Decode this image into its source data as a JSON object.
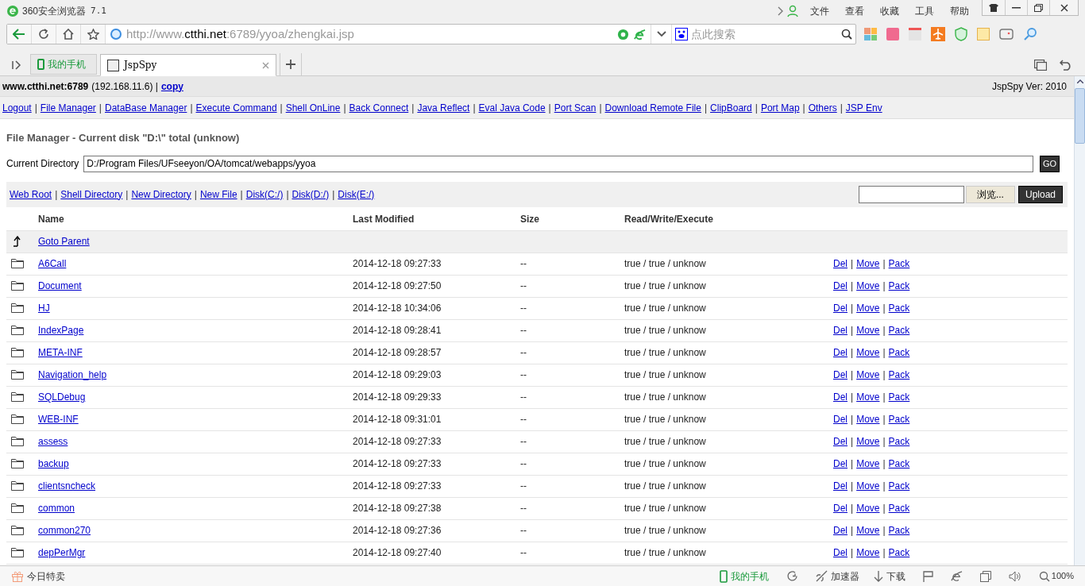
{
  "window": {
    "title": "360安全浏览器",
    "version": "7.1",
    "menu": [
      "文件",
      "查看",
      "收藏",
      "工具",
      "帮助"
    ]
  },
  "address_bar": {
    "url_scheme": "http://www.",
    "url_domain": "ctthi.net",
    "url_rest": ":6789/yyoa/zhengkai.jsp",
    "search_placeholder": "点此搜索"
  },
  "tabs": [
    {
      "label": "我的手机",
      "kind": "phone",
      "selected": false
    },
    {
      "label": "JspSpy",
      "kind": "page",
      "selected": true
    }
  ],
  "page": {
    "separator": "|",
    "host": "www.ctthi.net:6789",
    "ip": "(192.168.11.6) |",
    "copy_link": "copy",
    "version": "JspSpy Ver: 2010",
    "nav": [
      "Logout",
      "File Manager",
      "DataBase Manager",
      "Execute Command",
      "Shell OnLine",
      "Back Connect",
      "Java Reflect",
      "Eval Java Code",
      "Port Scan",
      "Download Remote File",
      "ClipBoard",
      "Port Map",
      "Others",
      "JSP Env"
    ],
    "heading": "File Manager - Current disk \"D:\\\" total (unknow)",
    "current_directory": {
      "label": "Current Directory",
      "value": "D:/Program Files/UFseeyon/OA/tomcat/webapps/yyoa",
      "button": "GO"
    },
    "toolbar_links": [
      "Web Root",
      "Shell Directory",
      "New Directory",
      "New File",
      "Disk(C:/)",
      "Disk(D:/)",
      "Disk(E:/)"
    ],
    "upload": {
      "browse": "浏览...",
      "button": "Upload"
    },
    "table": {
      "columns": [
        "Name",
        "Last Modified",
        "Size",
        "Read/Write/Execute"
      ],
      "parent_link": "Goto Parent",
      "rows": [
        {
          "name": "A6Call",
          "modified": "2014-12-18 09:27:33",
          "size": "--",
          "rwx": "true / true / unknow",
          "actions": [
            "Del",
            "Move",
            "Pack"
          ]
        },
        {
          "name": "Document",
          "modified": "2014-12-18 09:27:50",
          "size": "--",
          "rwx": "true / true / unknow",
          "actions": [
            "Del",
            "Move",
            "Pack"
          ]
        },
        {
          "name": "HJ",
          "modified": "2014-12-18 10:34:06",
          "size": "--",
          "rwx": "true / true / unknow",
          "actions": [
            "Del",
            "Move",
            "Pack"
          ]
        },
        {
          "name": "IndexPage",
          "modified": "2014-12-18 09:28:41",
          "size": "--",
          "rwx": "true / true / unknow",
          "actions": [
            "Del",
            "Move",
            "Pack"
          ]
        },
        {
          "name": "META-INF",
          "modified": "2014-12-18 09:28:57",
          "size": "--",
          "rwx": "true / true / unknow",
          "actions": [
            "Del",
            "Move",
            "Pack"
          ]
        },
        {
          "name": "Navigation_help",
          "modified": "2014-12-18 09:29:03",
          "size": "--",
          "rwx": "true / true / unknow",
          "actions": [
            "Del",
            "Move",
            "Pack"
          ]
        },
        {
          "name": "SQLDebug",
          "modified": "2014-12-18 09:29:33",
          "size": "--",
          "rwx": "true / true / unknow",
          "actions": [
            "Del",
            "Move",
            "Pack"
          ]
        },
        {
          "name": "WEB-INF",
          "modified": "2014-12-18 09:31:01",
          "size": "--",
          "rwx": "true / true / unknow",
          "actions": [
            "Del",
            "Move",
            "Pack"
          ]
        },
        {
          "name": "assess",
          "modified": "2014-12-18 09:27:33",
          "size": "--",
          "rwx": "true / true / unknow",
          "actions": [
            "Del",
            "Move",
            "Pack"
          ]
        },
        {
          "name": "backup",
          "modified": "2014-12-18 09:27:33",
          "size": "--",
          "rwx": "true / true / unknow",
          "actions": [
            "Del",
            "Move",
            "Pack"
          ]
        },
        {
          "name": "clientsncheck",
          "modified": "2014-12-18 09:27:33",
          "size": "--",
          "rwx": "true / true / unknow",
          "actions": [
            "Del",
            "Move",
            "Pack"
          ]
        },
        {
          "name": "common",
          "modified": "2014-12-18 09:27:38",
          "size": "--",
          "rwx": "true / true / unknow",
          "actions": [
            "Del",
            "Move",
            "Pack"
          ]
        },
        {
          "name": "common270",
          "modified": "2014-12-18 09:27:36",
          "size": "--",
          "rwx": "true / true / unknow",
          "actions": [
            "Del",
            "Move",
            "Pack"
          ]
        },
        {
          "name": "depPerMgr",
          "modified": "2014-12-18 09:27:40",
          "size": "--",
          "rwx": "true / true / unknow",
          "actions": [
            "Del",
            "Move",
            "Pack"
          ]
        }
      ]
    }
  },
  "status_bar": {
    "left": "今日特卖",
    "phone": "我的手机",
    "accelerator": "加速器",
    "download": "下载",
    "zoom": "100%"
  }
}
